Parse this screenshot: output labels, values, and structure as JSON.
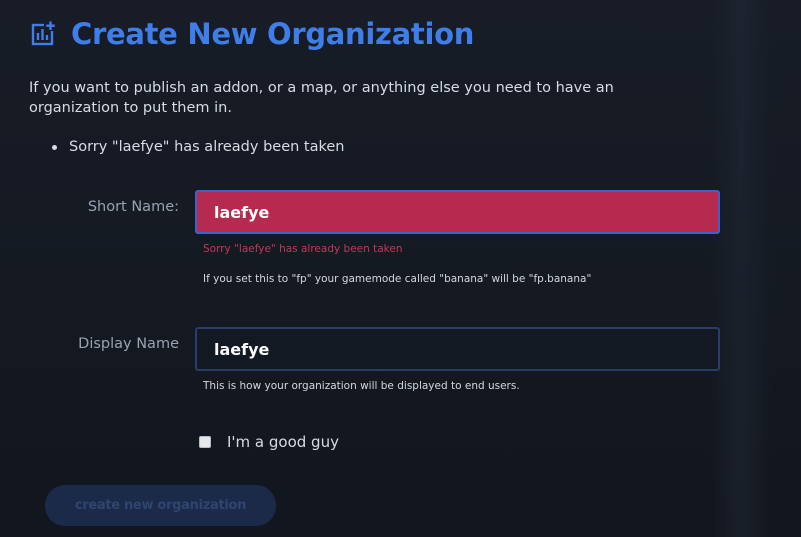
{
  "page": {
    "title": "Create New Organization",
    "title_icon": "add-chart-icon",
    "accent_color": "#3f7ee8",
    "intro": "If you want to publish an addon, or a map, or anything else you need to have an organization to put them in."
  },
  "errors": [
    "Sorry \"laefye\" has already been taken"
  ],
  "form": {
    "short_name": {
      "label": "Short Name:",
      "value": "laefye",
      "error": "Sorry \"laefye\" has already been taken",
      "help": "If you set this to \"fp\" your gamemode called \"banana\" will be \"fp.banana\"",
      "error_color": "#b52a4e"
    },
    "display_name": {
      "label": "Display Name",
      "value": "laefye",
      "help": "This is how your organization will be displayed to end users."
    },
    "good_guy": {
      "label": "I'm a good guy",
      "checked": false
    },
    "submit_label": "create new organization"
  }
}
